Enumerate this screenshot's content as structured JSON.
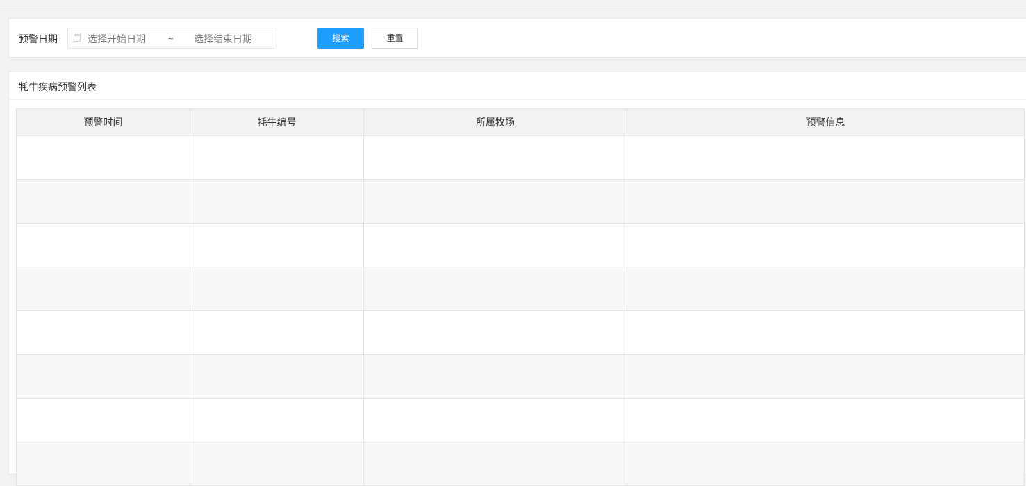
{
  "search": {
    "date_label": "预警日期",
    "start_placeholder": "选择开始日期",
    "separator": "~",
    "end_placeholder": "选择结束日期",
    "search_button": "搜索",
    "reset_button": "重置"
  },
  "list": {
    "title": "牦牛疾病预警列表",
    "columns": [
      "预警时间",
      "牦牛编号",
      "所属牧场",
      "预警信息"
    ],
    "rows": [
      [
        "",
        "",
        "",
        ""
      ],
      [
        "",
        "",
        "",
        ""
      ],
      [
        "",
        "",
        "",
        ""
      ],
      [
        "",
        "",
        "",
        ""
      ],
      [
        "",
        "",
        "",
        ""
      ],
      [
        "",
        "",
        "",
        ""
      ],
      [
        "",
        "",
        "",
        ""
      ],
      [
        "",
        "",
        "",
        ""
      ]
    ]
  },
  "colors": {
    "primary_button": "#1e9fff",
    "page_background": "#f2f2f2",
    "table_stripe": "#f7f7f7"
  }
}
